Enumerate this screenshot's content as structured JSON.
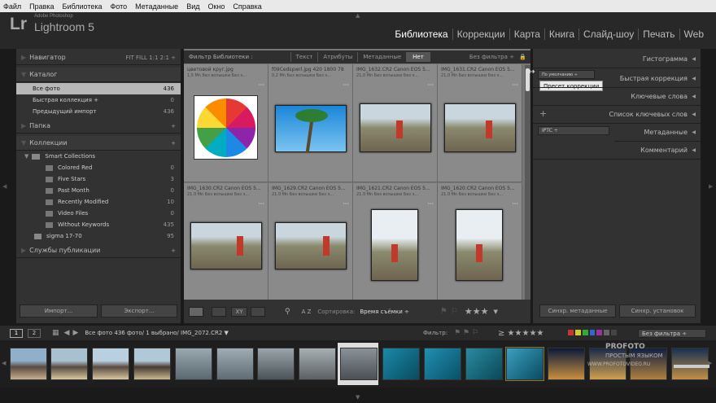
{
  "menu": [
    "Файл",
    "Правка",
    "Библиотека",
    "Фото",
    "Метаданные",
    "Вид",
    "Окно",
    "Справка"
  ],
  "app": {
    "logo": "Lr",
    "vendor": "Adobe Photoshop",
    "product": "Lightroom 5"
  },
  "modules": [
    "Библиотека",
    "Коррекции",
    "Карта",
    "Книга",
    "Слайд-шоу",
    "Печать",
    "Web"
  ],
  "left": {
    "navigator": {
      "title": "Навигатор",
      "zoom": "FIT  FILL  1:1  2:1 ÷"
    },
    "catalog": {
      "title": "Каталог",
      "items": [
        {
          "label": "Все фото",
          "count": "436"
        },
        {
          "label": "Быстрая коллекция +",
          "count": "0"
        },
        {
          "label": "Предыдущий импорт",
          "count": "436"
        }
      ]
    },
    "folders": {
      "title": "Папка",
      "action": "+"
    },
    "collections": {
      "title": "Коллекции",
      "action": "+",
      "group": "Smart Collections",
      "items": [
        {
          "label": "Colored Red",
          "count": "0"
        },
        {
          "label": "Five Stars",
          "count": "3"
        },
        {
          "label": "Past Month",
          "count": "0"
        },
        {
          "label": "Recently Modified",
          "count": "10"
        },
        {
          "label": "Video Files",
          "count": "0"
        },
        {
          "label": "Without Keywords",
          "count": "435"
        }
      ],
      "extra": {
        "label": "sigma 17-70",
        "count": "95"
      }
    },
    "publish": {
      "title": "Службы публикации",
      "action": "+"
    },
    "import": "Импорт...",
    "export": "Экспорт..."
  },
  "filter": {
    "title": "Фильтр Библиотеки :",
    "tabs": [
      "Текст",
      "Атрибуты",
      "Метаданные",
      "Нет"
    ],
    "preset": "Без фильтра ÷"
  },
  "grid": [
    {
      "name": "цветовой круг.jpg",
      "sub": "1,5 Mn  Без вспышки  Без э...",
      "kind": "wheel"
    },
    {
      "name": "f09Cedspwrl.jpg   420 1800 78",
      "sub": "0,2 Mn  Без вспышки  Без э...",
      "kind": "palm"
    },
    {
      "name": "IMG_1632.CR2   Canon EOS 5...",
      "sub": "21,0 Mn  Без вспышки  Без э...",
      "kind": "girl"
    },
    {
      "name": "IMG_1631.CR2   Canon EOS 5...",
      "sub": "21,0 Mn  Без вспышки  Без э...",
      "kind": "girl"
    },
    {
      "name": "IMG_1630.CR2   Canon EOS 5...",
      "sub": "21,0 Mn  Без вспышки  Без э...",
      "kind": "girl"
    },
    {
      "name": "IMG_1629.CR2   Canon EOS 5...",
      "sub": "21,0 Mn  Без вспышки  Без э...",
      "kind": "girl"
    },
    {
      "name": "IMG_1621.CR2   Canon EOS 5...",
      "sub": "21,0 Mn  Без вспышки  Без э...",
      "kind": "tall"
    },
    {
      "name": "IMG_1620.CR2   Canon EOS 5...",
      "sub": "21,0 Mn  Без вспышки  Без э...",
      "kind": "tall"
    }
  ],
  "toolbar": {
    "sort_label": "Сортировка:",
    "sort_value": "Время съёмки ÷",
    "az": "A Z"
  },
  "right": {
    "histogram": "Гистограмма",
    "quick": {
      "title": "Быстрая коррекция",
      "preset_value": "По умолчанию ÷",
      "tooltip": "Пресет коррекции"
    },
    "keywords": "Ключевые слова",
    "keywordlist": {
      "title": "Список ключевых слов",
      "plus": "+"
    },
    "metadata": {
      "title": "Метаданные",
      "preset": "IPTC ÷"
    },
    "comments": "Комментарий",
    "sync_meta": "Синхр. метаданные",
    "sync_settings": "Синхр. установок"
  },
  "filmstrip": {
    "pages": [
      "1",
      "2"
    ],
    "path": "Все фото  436 фото/ 1 выбрано/ IMG_2072.CR2 ▼",
    "filter_label": "Фильтр:",
    "filter_value": "Без фильтра ÷",
    "watermark1": "PROFOTO",
    "watermark2": "ПРОСТЫМ ЯЗЫКОМ",
    "watermark3": "WWW.PROFOTOVIDEO.RU"
  },
  "colors": {
    "accent": "#ffffff",
    "selected": "#b8b8b8"
  }
}
